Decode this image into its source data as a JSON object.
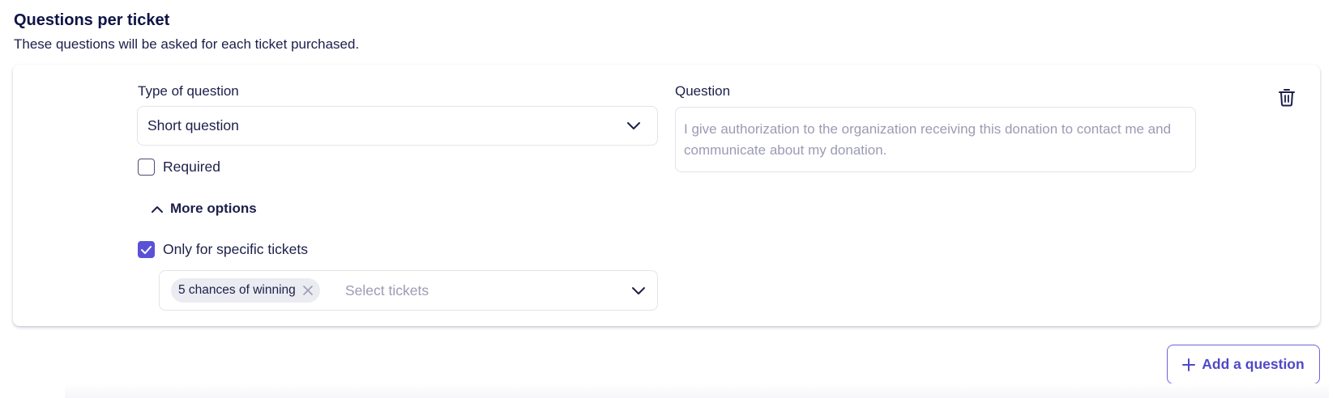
{
  "section": {
    "title": "Questions per ticket",
    "subtitle": "These questions will be asked for each ticket purchased."
  },
  "question_card": {
    "type_label": "Type of question",
    "type_value": "Short question",
    "required_label": "Required",
    "required_checked": false,
    "more_options_label": "More options",
    "specific_tickets_label": "Only for specific tickets",
    "specific_tickets_checked": true,
    "tickets": {
      "selected": [
        "5 chances of winning"
      ],
      "placeholder": "Select tickets"
    },
    "question_label": "Question",
    "question_placeholder": "I give authorization to the organization receiving this donation to contact me and communicate about my donation."
  },
  "add_button_label": "Add a question",
  "colors": {
    "accent": "#5a52d5",
    "text_dark": "#0f1446",
    "placeholder": "#9b9bb4",
    "chip_bg": "#ebebf2"
  },
  "icons": {
    "type_dropdown": "chevron-down-icon",
    "more_options": "chevron-up-icon",
    "checkbox_checked": "checkmark-icon",
    "chip_remove": "close-icon",
    "tickets_dropdown": "chevron-down-icon",
    "delete": "trash-icon",
    "add": "plus-icon"
  }
}
